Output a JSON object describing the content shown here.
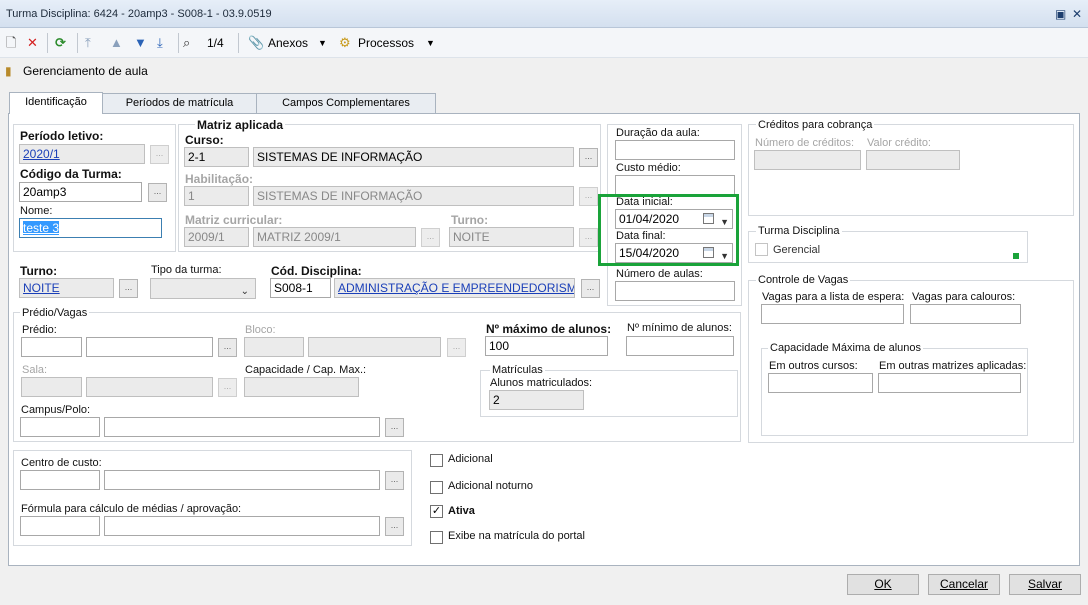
{
  "window": {
    "title": "Turma Disciplina: 6424 - 20amp3 - S008-1 - 03.9.0519"
  },
  "toolbar": {
    "page": "1/4",
    "anexos": "Anexos",
    "processos": "Processos"
  },
  "page_header": {
    "title": "Gerenciamento de aula"
  },
  "tabs": [
    "Identificação",
    "Períodos de matrícula",
    "Campos Complementares"
  ],
  "left": {
    "periodo_label": "Período letivo:",
    "periodo_value": "2020/1",
    "codigo_label": "Código da Turma:",
    "codigo_value": "20amp3",
    "nome_label": "Nome:",
    "nome_value": "teste 3"
  },
  "matriz": {
    "title": "Matriz aplicada",
    "curso_label": "Curso:",
    "curso_code": "2-1",
    "curso_name": "SISTEMAS DE INFORMAÇÃO",
    "habilitacao_label": "Habilitação:",
    "habilitacao_code": "1",
    "habilitacao_name": "SISTEMAS DE INFORMAÇÃO",
    "matriz_label": "Matriz curricular:",
    "matriz_code": "2009/1",
    "matriz_name": "MATRIZ 2009/1",
    "turno_label": "Turno:",
    "turno_value": "NOITE"
  },
  "aula": {
    "duracao_label": "Duração da aula:",
    "custo_label": "Custo médio:",
    "data_inicial_label": "Data inicial:",
    "data_inicial": "01/04/2020",
    "data_final_label": "Data final:",
    "data_final": "15/04/2020",
    "numero_label": "Número de aulas:"
  },
  "creditos": {
    "title": "Créditos para cobrança",
    "numero_label": "Número de créditos:",
    "valor_label": "Valor crédito:"
  },
  "turma_disciplina": {
    "title": "Turma Disciplina",
    "gerencial": "Gerencial"
  },
  "row2": {
    "turno_label": "Turno:",
    "turno_value": "NOITE",
    "tipo_label": "Tipo da turma:",
    "cod_label": "Cód. Disciplina:",
    "cod_value": "S008-1",
    "disciplina_name": "ADMINISTRAÇÃO E EMPREENDEDORISMO I"
  },
  "predio": {
    "title": "Prédio/Vagas",
    "predio_label": "Prédio:",
    "bloco_label": "Bloco:",
    "max_label": "Nº máximo de alunos:",
    "max_value": "100",
    "min_label": "Nº mínimo de alunos:",
    "sala_label": "Sala:",
    "capacidade_label": "Capacidade / Cap. Max.:",
    "matriculas_title": "Matrículas",
    "matriculados_label": "Alunos matriculados:",
    "matriculados_value": "2",
    "campus_label": "Campus/Polo:"
  },
  "vagas": {
    "title": "Controle de Vagas",
    "espera_label": "Vagas para a lista de espera:",
    "calouros_label": "Vagas para calouros:",
    "cap_title": "Capacidade Máxima de alunos",
    "outros_cursos_label": "Em outros cursos:",
    "outras_matrizes_label": "Em outras matrizes aplicadas:"
  },
  "bottom": {
    "centro_label": "Centro de custo:",
    "formula_label": "Fórmula para cálculo de médias / aprovação:",
    "adicional": "Adicional",
    "adicional_noturno": "Adicional noturno",
    "ativa": "Ativa",
    "exibe": "Exibe na matrícula do portal"
  },
  "buttons": {
    "ok": "OK",
    "cancelar": "Cancelar",
    "salvar": "Salvar"
  },
  "colors": {
    "highlight": "#1aa33a",
    "link": "#1a3fb8"
  }
}
